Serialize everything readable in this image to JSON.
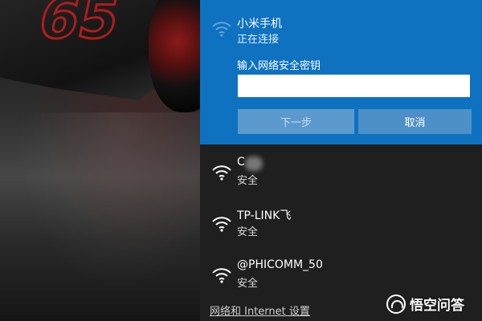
{
  "active_network": {
    "name": "小米手机",
    "status": "正在连接",
    "key_label": "输入网络安全密钥",
    "key_value": "",
    "next_button": "下一步",
    "cancel_button": "取消",
    "icon": "wifi-icon"
  },
  "networks": [
    {
      "name": "C",
      "status": "安全",
      "icon": "wifi-icon"
    },
    {
      "name": "TP-LINK飞",
      "status": "安全",
      "icon": "wifi-icon"
    },
    {
      "name": "@PHICOMM_50",
      "status": "安全",
      "icon": "wifi-icon"
    }
  ],
  "footer": {
    "settings_link": "网络和 Internet 设置"
  },
  "watermark": {
    "text": "悟空问答"
  },
  "colors": {
    "accent": "#0e72c1",
    "panel_bg": "#1f1f1f"
  }
}
